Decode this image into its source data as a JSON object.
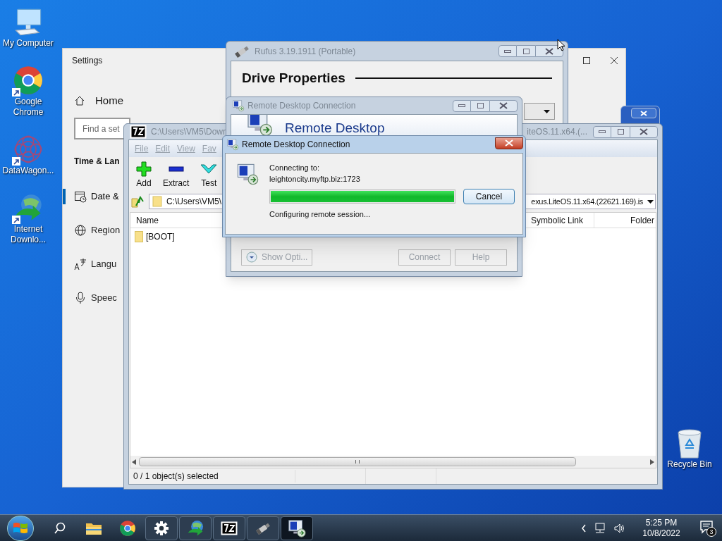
{
  "desktop_icons": [
    {
      "kind": "computer",
      "label": "My Computer"
    },
    {
      "kind": "chrome",
      "label": "Google Chrome"
    },
    {
      "kind": "flower",
      "label": "DataWagon..."
    },
    {
      "kind": "idm",
      "label": "Internet Downlo..."
    }
  ],
  "recycle_bin": {
    "label": "Recycle Bin"
  },
  "settings": {
    "title": "Settings",
    "home": "Home",
    "search_placeholder": "Find a set",
    "section": "Time & Lan",
    "nav": [
      {
        "kind": "calendar",
        "label": "Date &",
        "selected": true
      },
      {
        "kind": "globe",
        "label": "Region",
        "selected": false
      },
      {
        "kind": "language",
        "label": "Langu",
        "selected": false
      },
      {
        "kind": "mic",
        "label": "Speec",
        "selected": false
      }
    ]
  },
  "rufus": {
    "title": "Rufus 3.19.1911 (Portable)",
    "heading": "Drive Properties"
  },
  "sevenzip": {
    "title": "C:\\Users\\VM5\\Down",
    "title_right": "iteOS.11.x64.(...",
    "menu": [
      "File",
      "Edit",
      "View",
      "Fav"
    ],
    "toolbar": [
      {
        "kind": "add",
        "label": "Add"
      },
      {
        "kind": "extract",
        "label": "Extract"
      },
      {
        "kind": "test",
        "label": "Test"
      }
    ],
    "address": "C:\\Users\\VM5\\",
    "address_right": "exus.LiteOS.11.x64.(22621.169).is",
    "columns": [
      "Name",
      "Symbolic Link",
      "Folder"
    ],
    "rows": [
      {
        "name": "[BOOT]",
        "selected": false
      }
    ],
    "status": "0 / 1 object(s) selected"
  },
  "rdc_main": {
    "title": "Remote Desktop Connection",
    "banner": "Remote Desktop",
    "buttons": [
      {
        "label": "Show Opti...",
        "kind": "options",
        "disabled": true
      },
      {
        "label": "Connect",
        "kind": "plain",
        "disabled": true
      },
      {
        "label": "Help",
        "kind": "plain",
        "disabled": true
      }
    ]
  },
  "rdc_dialog": {
    "title": "Remote Desktop Connection",
    "connecting_label": "Connecting to:",
    "host": "leightoncity.myftp.biz:1723",
    "progress": {
      "level": 1.0
    },
    "cancel": "Cancel",
    "status": "Configuring remote session..."
  },
  "taskbar": {
    "items": [
      {
        "kind": "search",
        "open": false,
        "selected": false
      },
      {
        "kind": "folder",
        "open": false,
        "selected": false
      },
      {
        "kind": "chrome",
        "open": false,
        "selected": false
      },
      {
        "kind": "gear",
        "open": true,
        "selected": false
      },
      {
        "kind": "idm",
        "open": true,
        "selected": false
      },
      {
        "kind": "archive",
        "open": true,
        "selected": false
      },
      {
        "kind": "usb",
        "open": true,
        "selected": false
      },
      {
        "kind": "rdc",
        "open": true,
        "selected": true
      }
    ],
    "time": "5:25 PM",
    "date": "10/8/2022",
    "notifications": "3"
  }
}
